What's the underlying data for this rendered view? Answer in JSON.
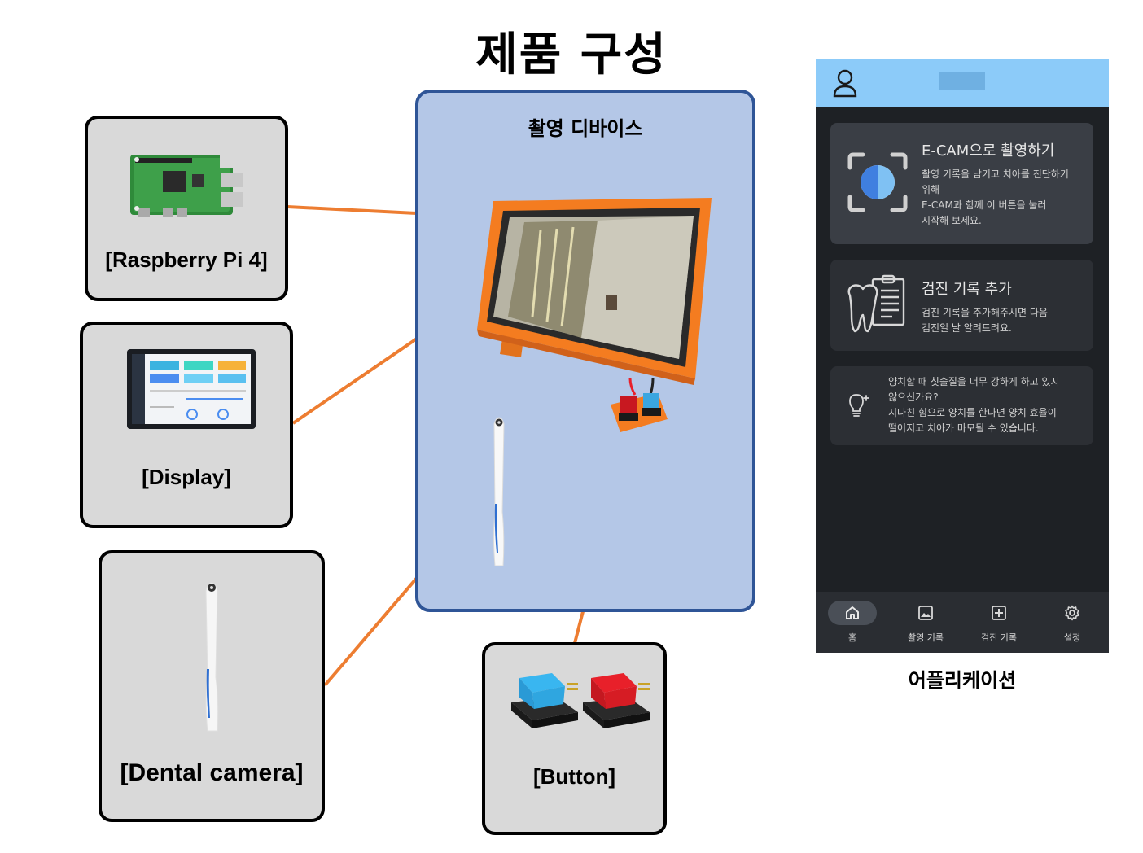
{
  "title": "제품 구성",
  "device": {
    "title": "촬영 디바이스"
  },
  "components": {
    "raspberry": "[Raspberry Pi 4]",
    "display": "[Display]",
    "camera": "[Dental camera]",
    "button": "[Button]"
  },
  "app": {
    "caption": "어플리케이션",
    "cards": [
      {
        "title": "E-CAM으로 촬영하기",
        "body": "촬영 기록을 남기고 치아를 진단하기\n위해\nE-CAM과 함께 이 버튼을 눌러\n시작해 보세요."
      },
      {
        "title": "검진 기록 추가",
        "body": "검진 기록을 추가해주시면 다음\n검진일 날 알려드려요."
      },
      {
        "title": "",
        "body": "양치할 때 칫솔질을 너무 강하게 하고 있지\n않으신가요?\n지나친 힘으로 양치를 한다면 양치 효율이\n떨어지고 치아가 마모될 수 있습니다."
      }
    ],
    "nav": [
      {
        "label": "홈",
        "icon": "home-icon",
        "active": true
      },
      {
        "label": "촬영 기록",
        "icon": "image-icon",
        "active": false
      },
      {
        "label": "검진 기록",
        "icon": "plus-box-icon",
        "active": false
      },
      {
        "label": "설정",
        "icon": "gear-icon",
        "active": false
      }
    ]
  },
  "colors": {
    "device_bg": "#b4c7e7",
    "device_border": "#2f5597",
    "component_bg": "#d9d9d9",
    "connector": "#ed7d31",
    "app_header": "#8ccbf9",
    "app_bg": "#1e2125",
    "enclosure_orange": "#f47c20"
  }
}
